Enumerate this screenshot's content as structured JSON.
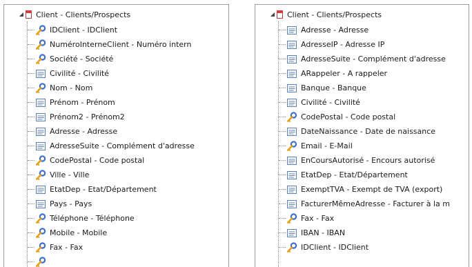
{
  "left_panel": {
    "root_label": "Client - Clients/Prospects",
    "items": [
      {
        "label": "IDClient - IDClient",
        "icon": "key-icon"
      },
      {
        "label": "NuméroInterneClient - Numéro intern",
        "icon": "key-icon"
      },
      {
        "label": "Société - Société",
        "icon": "key-icon"
      },
      {
        "label": "Civilité - Civilité",
        "icon": "field-icon"
      },
      {
        "label": "Nom - Nom",
        "icon": "key-icon"
      },
      {
        "label": "Prénom - Prénom",
        "icon": "field-icon"
      },
      {
        "label": "Prénom2 - Prénom2",
        "icon": "field-icon"
      },
      {
        "label": "Adresse - Adresse",
        "icon": "field-icon"
      },
      {
        "label": "AdresseSuite - Complément d'adresse",
        "icon": "field-icon"
      },
      {
        "label": "CodePostal - Code postal",
        "icon": "key-icon"
      },
      {
        "label": "Ville - Ville",
        "icon": "key-icon"
      },
      {
        "label": "EtatDep - Etat/Département",
        "icon": "field-icon"
      },
      {
        "label": "Pays - Pays",
        "icon": "field-icon"
      },
      {
        "label": "Téléphone - Téléphone",
        "icon": "key-icon"
      },
      {
        "label": "Mobile - Mobile",
        "icon": "key-icon"
      },
      {
        "label": "Fax - Fax",
        "icon": "key-icon"
      },
      {
        "label": "",
        "icon": "key-icon"
      }
    ]
  },
  "right_panel": {
    "root_label": "Client - Clients/Prospects",
    "items": [
      {
        "label": "Adresse - Adresse",
        "icon": "field-icon"
      },
      {
        "label": "AdresseIP - Adresse IP",
        "icon": "field-icon"
      },
      {
        "label": "AdresseSuite - Complément d'adresse",
        "icon": "field-icon"
      },
      {
        "label": "ARappeler - A rappeler",
        "icon": "field-icon"
      },
      {
        "label": "Banque - Banque",
        "icon": "field-icon"
      },
      {
        "label": "Civilité - Civilité",
        "icon": "field-icon"
      },
      {
        "label": "CodePostal - Code postal",
        "icon": "key-icon"
      },
      {
        "label": "DateNaissance - Date de naissance",
        "icon": "field-icon"
      },
      {
        "label": "Email - E-Mail",
        "icon": "key-icon"
      },
      {
        "label": "EnCoursAutorisé - Encours autorisé",
        "icon": "field-icon"
      },
      {
        "label": "EtatDep - Etat/Département",
        "icon": "field-icon"
      },
      {
        "label": "ExemptTVA - Exempt de TVA (export)",
        "icon": "field-icon"
      },
      {
        "label": "FacturerMêmeAdresse - Facturer à la m",
        "icon": "field-icon"
      },
      {
        "label": "Fax - Fax",
        "icon": "key-icon"
      },
      {
        "label": "IBAN - IBAN",
        "icon": "field-icon"
      },
      {
        "label": "IDClient - IDClient",
        "icon": "key-icon"
      }
    ]
  },
  "colors": {
    "key_handle": "#3f6fc8",
    "key_bit": "#e2a21c",
    "field_border": "#5a7fb8",
    "table_header": "#d63a3a"
  }
}
